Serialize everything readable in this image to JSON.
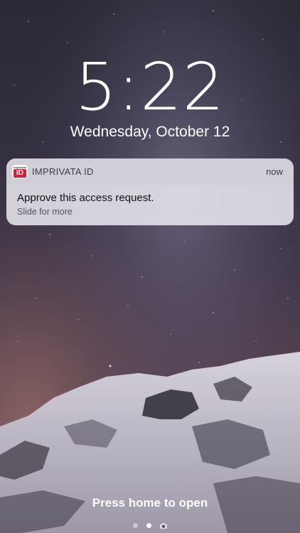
{
  "lock_screen": {
    "time": "5:22",
    "date": "Wednesday, October 12",
    "bottom_hint": "Press home to open"
  },
  "notification": {
    "app_name": "IMPRIVATA ID",
    "app_icon": "imprivata-id-icon",
    "app_icon_small_text": "imprivata",
    "app_icon_badge": "ID",
    "time": "now",
    "title": "Approve this access request.",
    "subtitle": "Slide for more"
  },
  "pager": {
    "pages": 2,
    "current_page": 2,
    "camera_icon": "camera-icon"
  },
  "colors": {
    "icon_red": "#d21f3c",
    "text_white": "#ffffff"
  }
}
